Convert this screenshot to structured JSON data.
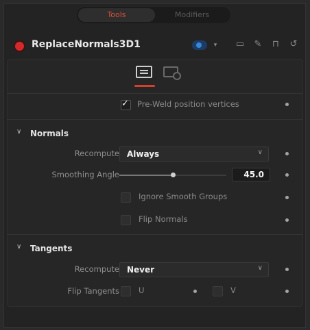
{
  "tabs": {
    "tools": "Tools",
    "modifiers": "Modifiers"
  },
  "header": {
    "node_name": "ReplaceNormals3D1"
  },
  "colors": {
    "accent": "#d3412c",
    "node_dot": "#d22a2a",
    "blue_pill": "#3a86d6"
  },
  "top": {
    "preweld_label": "Pre-Weld position vertices",
    "preweld_checked": true
  },
  "normals": {
    "title": "Normals",
    "recompute_label": "Recompute",
    "recompute_value": "Always",
    "smoothing_label": "Smoothing Angle",
    "smoothing_value": "45.0",
    "smoothing_fraction": 0.5,
    "ignore_label": "Ignore Smooth Groups",
    "ignore_checked": false,
    "flip_label": "Flip Normals",
    "flip_checked": false
  },
  "tangents": {
    "title": "Tangents",
    "recompute_label": "Recompute",
    "recompute_value": "Never",
    "flip_label": "Flip Tangents",
    "u_label": "U",
    "v_label": "V",
    "u_checked": false,
    "v_checked": false
  },
  "icons": {
    "collapse": "chevron-down-icon",
    "dropdown": "chevron-down-icon",
    "header": [
      "window-icon",
      "pin-icon",
      "lock-icon",
      "reset-icon"
    ]
  }
}
